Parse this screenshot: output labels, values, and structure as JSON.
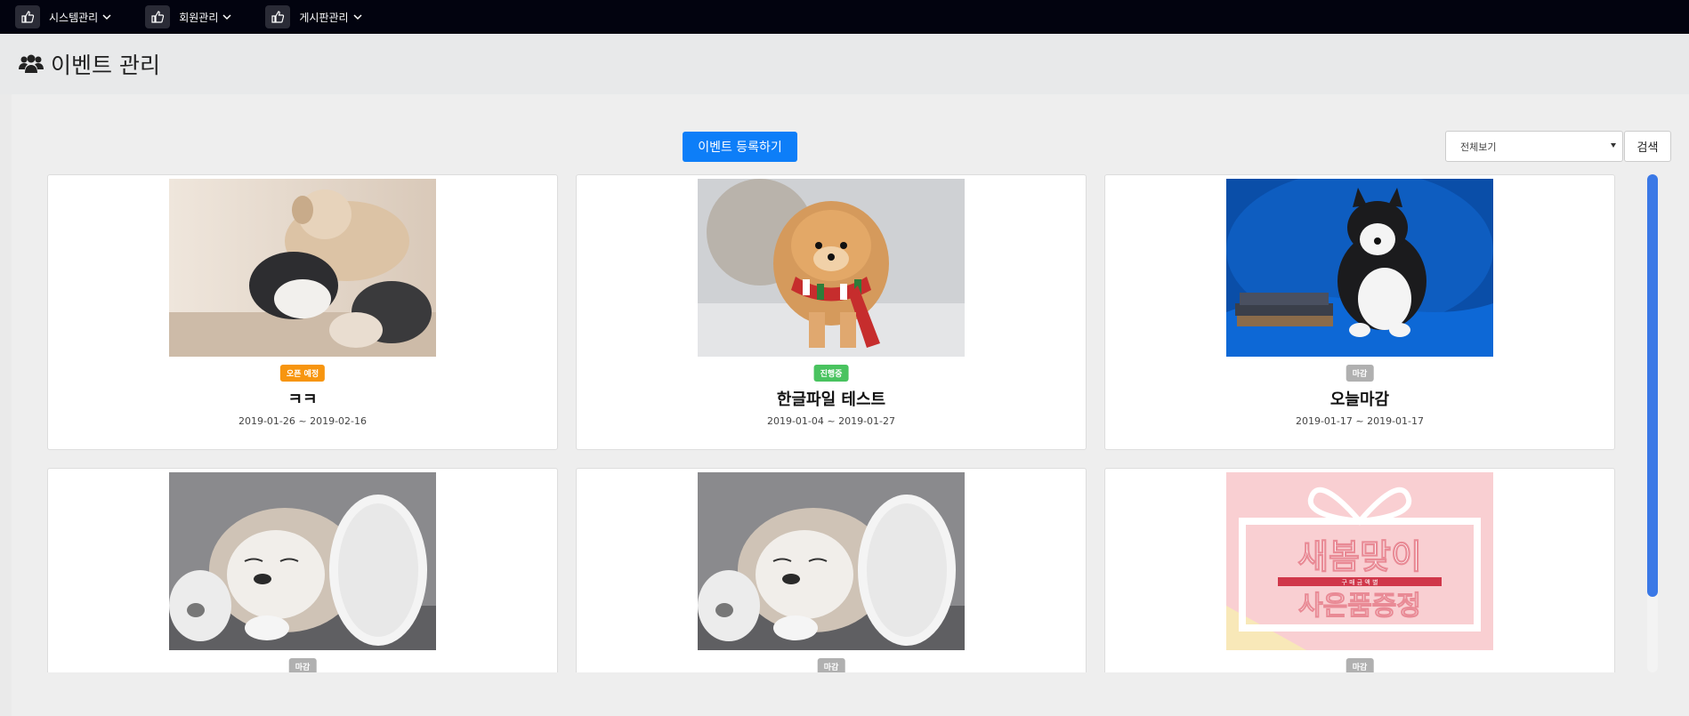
{
  "nav": {
    "items": [
      {
        "label": "시스템관리",
        "icon": "thumb-pointer-icon"
      },
      {
        "label": "회원관리",
        "icon": "thumb-pointer-icon"
      },
      {
        "label": "게시판관리",
        "icon": "thumb-pointer-icon"
      }
    ]
  },
  "header": {
    "title": "이벤트 관리",
    "icon": "users-icon"
  },
  "toolbar": {
    "register_label": "이벤트 등록하기",
    "filter_value": "전체보기",
    "search_label": "검색"
  },
  "colors": {
    "nav_bg": "#02030f",
    "primary": "#0d7ef8",
    "badge_upcoming": "#f7950f",
    "badge_ongoing": "#49c35f",
    "badge_closed": "#b0b0b0",
    "scroll_thumb": "#3a78e6"
  },
  "cards": [
    {
      "badge": "오픈 예정",
      "status": "upcoming",
      "title": "ㅋㅋ",
      "date": "2019-01-26 ~ 2019-02-16",
      "image": "husky-puppies-playing"
    },
    {
      "badge": "진행중",
      "status": "ongoing",
      "title": "한글파일 테스트",
      "date": "2019-01-04 ~ 2019-01-27",
      "image": "pomeranian-with-scarf"
    },
    {
      "badge": "마감",
      "status": "closed",
      "title": "오늘마감",
      "date": "2019-01-17 ~ 2019-01-17",
      "image": "husky-puppy-on-books"
    },
    {
      "badge": "마감",
      "status": "closed",
      "title": "",
      "date": "",
      "image": "puppy-sleeping-on-toilet-paper"
    },
    {
      "badge": "마감",
      "status": "closed",
      "title": "",
      "date": "",
      "image": "puppy-sleeping-on-toilet-paper"
    },
    {
      "badge": "마감",
      "status": "closed",
      "title": "",
      "date": "",
      "image": "spring-gift-banner"
    }
  ],
  "banner": {
    "line1": "새봄맞이",
    "line2": "구 매 금 액 별",
    "line3": "사은품증정"
  }
}
